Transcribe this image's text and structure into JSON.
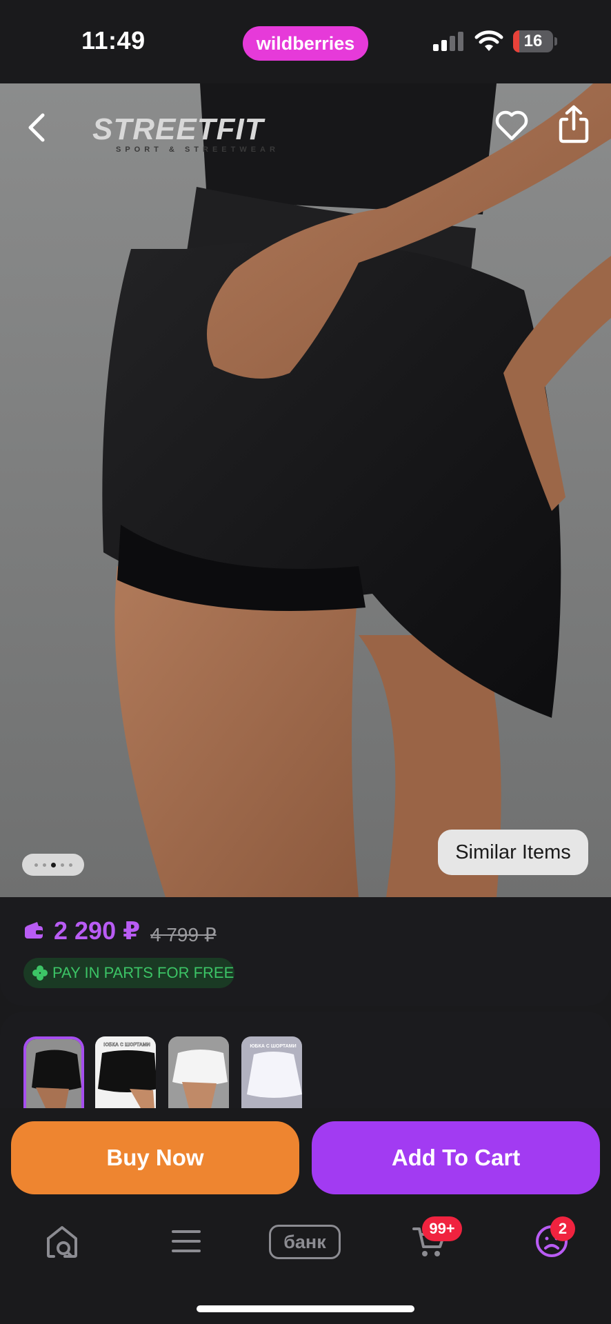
{
  "status_bar": {
    "time": "11:49",
    "brand": "wildberries",
    "brand_color": "#e63ad9",
    "battery_level": 16,
    "battery_level_fraction": 0.16,
    "icons": [
      "signal-icon",
      "wifi-icon",
      "battery-icon"
    ]
  },
  "header": {
    "back_icon": "chevron-left-icon",
    "logo_word": "STREETFIT",
    "logo_tagline": "SPORT & STREETWEAR",
    "favorite_icon": "heart-icon",
    "share_icon": "share-icon"
  },
  "gallery": {
    "image_count": 5,
    "active_index": 2,
    "similar_items_label": "Similar Items"
  },
  "price": {
    "current": "2 290 ₽",
    "old": "4 799 ₽",
    "accent_color": "#b95cf4",
    "pay_in_parts_label": "PAY IN PARTS FOR FREE"
  },
  "variants": [
    {
      "name": "black-skirt-front",
      "selected": true,
      "caption": ""
    },
    {
      "name": "black-skirt-side",
      "selected": false,
      "caption": "ЮБКА С ШОРТАМИ"
    },
    {
      "name": "white-skirt-front",
      "selected": false,
      "caption": ""
    },
    {
      "name": "white-skirt-side",
      "selected": false,
      "caption": "ЮБКА С ШОРТАМИ"
    }
  ],
  "actions": {
    "buy_now_label": "Buy Now",
    "add_to_cart_label": "Add To Cart",
    "buy_color": "#ee8530",
    "cart_color": "#a23bf2"
  },
  "tabbar": {
    "home_search_icon": "home-search-icon",
    "menu_icon": "menu-icon",
    "bank_label": "банк",
    "cart_icon": "cart-icon",
    "cart_badge": "99+",
    "profile_icon": "profile-icon",
    "profile_badge": "2"
  }
}
